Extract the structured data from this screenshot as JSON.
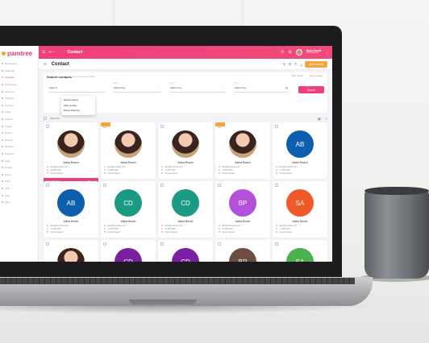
{
  "app": {
    "logo_text": "pamtree",
    "section": "Contact",
    "page_title": "Contact"
  },
  "user": {
    "name": "Rosy Scott",
    "role": "Administrator"
  },
  "toolbar": {
    "new_button": "Add Contact"
  },
  "sidebar": {
    "items": [
      "Dashboard",
      "Calendar",
      "Contacts",
      "Employees",
      "Accounts",
      "Invoices",
      "Projects",
      "Tasks",
      "Tickets",
      "Leads",
      "Deals",
      "Reports",
      "Settings",
      "Activities",
      "Calls",
      "Emails",
      "Notes",
      "Files",
      "Chat",
      "Help",
      "More"
    ]
  },
  "filter": {
    "title": "Search contacts",
    "hint": "Enter keyword to search",
    "links": [
      "Save Search",
      "Reset Search"
    ],
    "fields": [
      {
        "label": "",
        "value": "Search"
      },
      {
        "label": "Select",
        "value": "Select Key"
      },
      {
        "label": "Select",
        "value": "Select Key"
      },
      {
        "label": "Select",
        "value": "Select Key"
      }
    ],
    "search_button": "Search"
  },
  "grid": {
    "select_all": "Select All"
  },
  "menu": {
    "items": [
      "Mark as Read",
      "Hide Contact",
      "Delete Selected"
    ]
  },
  "cards": [
    {
      "type": "photo",
      "initials": "",
      "name": "Aisha Roach",
      "email": "aisha@example.com",
      "phone": "+1 555 0100",
      "action": "Current Aspect",
      "badge": "",
      "color": ""
    },
    {
      "type": "photo",
      "initials": "",
      "name": "Aisha Roach",
      "email": "aisha@example.com",
      "phone": "+1 555 0100",
      "action": "Current Aspect",
      "badge": "",
      "color": ""
    },
    {
      "type": "photo",
      "initials": "",
      "name": "Aisha Roach",
      "email": "aisha@example.com",
      "phone": "+1 555 0100",
      "action": "Current Aspect",
      "badge": "",
      "color": ""
    },
    {
      "type": "photo",
      "initials": "",
      "name": "Aisha Roach",
      "email": "aisha@example.com",
      "phone": "+1 555 0100",
      "action": "Current Aspect",
      "badge": "",
      "color": ""
    },
    {
      "type": "initials",
      "initials": "AB",
      "name": "Aisha Roach",
      "email": "aisha@example.com",
      "phone": "+1 555 0100",
      "action": "Current Aspect",
      "badge": "",
      "color": "#0d5fae"
    },
    {
      "type": "initials",
      "initials": "AB",
      "name": "Aisha Bosch",
      "email": "aisha@example.com",
      "phone": "+1 555 0100",
      "action": "Current Aspect",
      "badge": "",
      "color": "#0d5fae"
    },
    {
      "type": "initials",
      "initials": "CD",
      "name": "Aisha Bosch",
      "email": "aisha@example.com",
      "phone": "+1 555 0100",
      "action": "Current Aspect",
      "badge": "",
      "color": "#1b9a84"
    },
    {
      "type": "initials",
      "initials": "CD",
      "name": "Aisha Bosch",
      "email": "aisha@example.com",
      "phone": "+1 555 0100",
      "action": "Current Aspect",
      "badge": "",
      "color": "#1b9a84"
    },
    {
      "type": "initials",
      "initials": "BP",
      "name": "Aisha Bosch",
      "email": "aisha@example.com",
      "phone": "+1 555 0100",
      "action": "Current Aspect",
      "badge": "",
      "color": "#b34fd8"
    },
    {
      "type": "initials",
      "initials": "SA",
      "name": "Aisha Bosch",
      "email": "aisha@example.com",
      "phone": "+1 555 0100",
      "action": "Current Aspect",
      "badge": "",
      "color": "#f05a28"
    },
    {
      "type": "photo",
      "initials": "",
      "name": "",
      "email": "",
      "phone": "",
      "action": "",
      "badge": "",
      "color": ""
    },
    {
      "type": "initials",
      "initials": "CD",
      "name": "",
      "email": "",
      "phone": "",
      "action": "",
      "badge": "",
      "color": "#7b1fa2"
    },
    {
      "type": "initials",
      "initials": "CD",
      "name": "",
      "email": "",
      "phone": "",
      "action": "",
      "badge": "",
      "color": "#7b1fa2"
    },
    {
      "type": "initials",
      "initials": "BP",
      "name": "",
      "email": "",
      "phone": "",
      "action": "",
      "badge": "",
      "color": "#6d4c41"
    },
    {
      "type": "initials",
      "initials": "SA",
      "name": "",
      "email": "",
      "phone": "",
      "action": "",
      "badge": "",
      "color": "#4caf50"
    }
  ],
  "first_card_actions": {
    "label": "Send Message"
  },
  "colors": {
    "accent": "#ef3f7d",
    "orange": "#f5a33b"
  }
}
